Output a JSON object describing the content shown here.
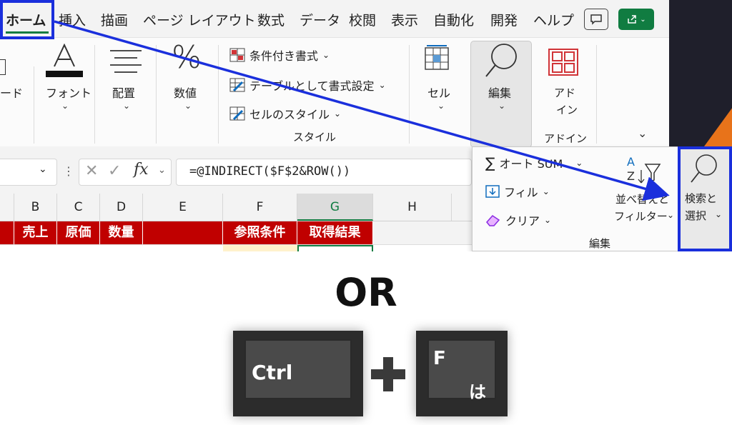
{
  "menu": {
    "tabs": [
      "ホーム",
      "挿入",
      "描画",
      "ページ レイアウト",
      "数式",
      "データ",
      "校閲",
      "表示",
      "自動化",
      "開発",
      "ヘルプ"
    ]
  },
  "ribbon": {
    "clipboard_label": "ード",
    "font_label": "フォント",
    "alignment_label": "配置",
    "number_label": "数値",
    "number_symbol": "%",
    "conditional_format": "条件付き書式",
    "format_as_table": "テーブルとして書式設定",
    "cell_styles": "セルのスタイル",
    "styles_group": "スタイル",
    "cells_label": "セル",
    "editing_label": "編集",
    "addins_label_1": "アド",
    "addins_label_2": "イン",
    "addins_group": "アドイン"
  },
  "formula_bar": {
    "fx": "fx",
    "formula": "=@INDIRECT($F$2&ROW())"
  },
  "columns": [
    "B",
    "C",
    "D",
    "E",
    "F",
    "G",
    "H"
  ],
  "header_row": {
    "B": "売上",
    "C": "原価",
    "D": "数量",
    "F": "参照条件",
    "G": "取得結果"
  },
  "editing_panel": {
    "autosum": "オート SUM",
    "fill": "フィル",
    "clear": "クリア",
    "sort_filter_1": "並べ替えと",
    "sort_filter_2": "フィルター",
    "find_select_1": "検索と",
    "find_select_2": "選択",
    "group": "編集"
  },
  "bottom": {
    "or": "OR",
    "key1": "Ctrl",
    "key2_main": "F",
    "key2_sub": "は"
  },
  "colors": {
    "highlight": "#1a2fdc",
    "header_red": "#c00000",
    "excel_green": "#107c41"
  }
}
